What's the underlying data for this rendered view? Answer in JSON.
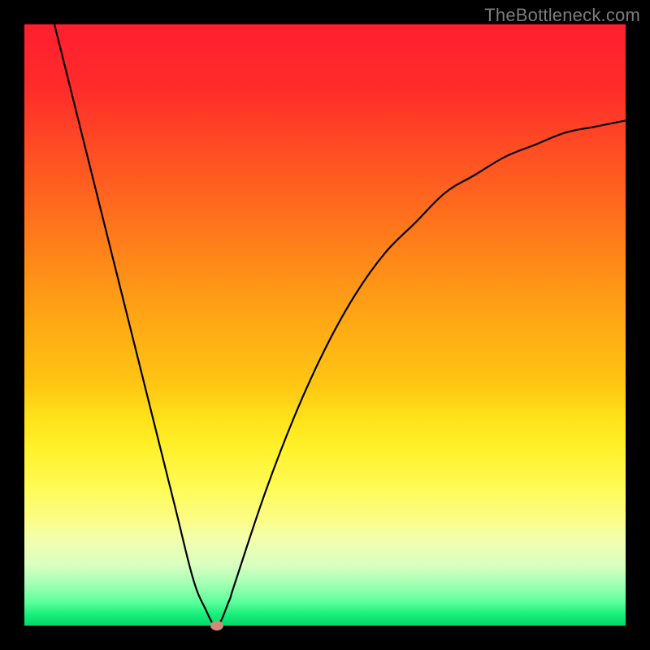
{
  "attribution": "TheBottleneck.com",
  "chart_data": {
    "type": "line",
    "title": "",
    "xlabel": "",
    "ylabel": "",
    "xlim": [
      0,
      100
    ],
    "ylim": [
      0,
      100
    ],
    "legend": false,
    "series": [
      {
        "name": "bottleneck-curve",
        "x": [
          5,
          10,
          15,
          20,
          25,
          28,
          30,
          32,
          34,
          35,
          40,
          45,
          50,
          55,
          60,
          65,
          70,
          75,
          80,
          85,
          90,
          95,
          100
        ],
        "y": [
          100,
          80,
          60,
          40,
          20,
          8,
          3,
          0,
          4,
          7,
          22,
          35,
          46,
          55,
          62,
          67,
          72,
          75,
          78,
          80,
          82,
          83,
          84
        ]
      }
    ],
    "annotations": [
      {
        "name": "optimum-marker",
        "x": 32,
        "y": 0
      }
    ],
    "background": {
      "type": "vertical-gradient",
      "stops": [
        {
          "pos": 0.0,
          "color": "#ff1f2f"
        },
        {
          "pos": 0.5,
          "color": "#ffaa14"
        },
        {
          "pos": 0.78,
          "color": "#fffb55"
        },
        {
          "pos": 1.0,
          "color": "#00d86a"
        }
      ]
    }
  }
}
